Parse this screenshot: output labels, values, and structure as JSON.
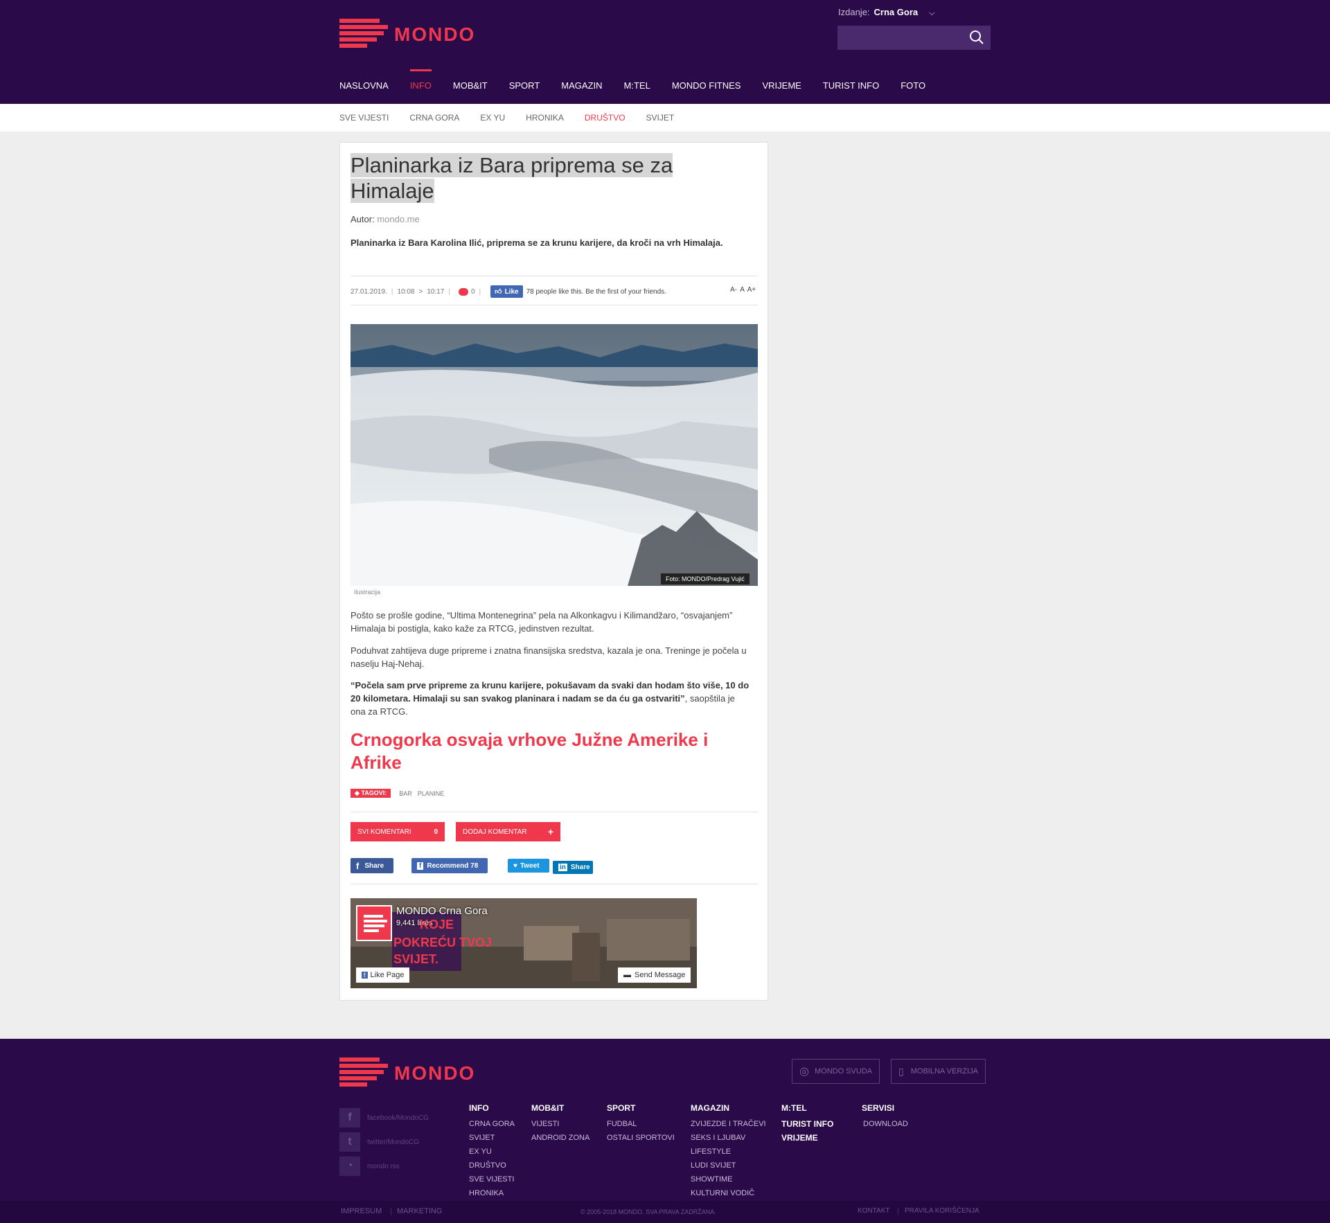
{
  "header": {
    "logo_text": "MONDO",
    "edition_label": "Izdanje:",
    "edition_value": "Crna Gora",
    "search_placeholder": ""
  },
  "main_nav": [
    "NASLOVNA",
    "INFO",
    "MOB&IT",
    "SPORT",
    "MAGAZIN",
    "M:TEL",
    "MONDO FITNES",
    "VRIJEME",
    "TURIST INFO",
    "FOTO"
  ],
  "main_nav_active": "INFO",
  "sub_nav": [
    "SVE VIJESTI",
    "CRNA GORA",
    "EX YU",
    "HRONIKA",
    "DRUŠTVO",
    "SVIJET"
  ],
  "sub_nav_active": "DRUŠTVO",
  "article": {
    "title": "Planinarka iz Bara priprema se za Himalaje",
    "author_label": "Autor:",
    "author": "mondo.me",
    "lead": "Planinarka iz Bara Karolina Ilić, priprema se za krunu karijere, da kroči na vrh Himalaja.",
    "date": "27.01.2019.",
    "time_published": "10:08",
    "arrow": ">",
    "time_updated": "10:17",
    "comments_count": "0",
    "fb_like_label": "Like",
    "fb_like_text": "78 people like this. Be the first of your friends.",
    "font_controls": "A- A A+",
    "photo_credit": "Foto: MONDO/Predrag Vujić",
    "photo_caption": "Ilustracija",
    "para1": "  Pošto se prošle godine, “Ultima Montenegrina” pela na Alkonkagvu i Kilimandžaro, “osvajanjem” Himalaja bi postigla, kako kaže za RTCG, jedinstven rezultat.",
    "para2": "Poduhvat zahtijeva duge pripreme i znatna finansijska sredstva, kazala je ona. Treninge je počela u naselju Haj-Nehaj.",
    "quote": "“Počela sam prve pripreme za krunu karijere, pokušavam da svaki dan hodam što više, 10 do 20 kilometara. Himalaji su san svakog planinara i nadam se da ću ga ostvariti”",
    "quote_tail": ", saopštila je ona za RTCG.",
    "subheading": "Crnogorka osvaja vrhove Južne Amerike i Afrike",
    "tags_label": "TAGOVI:",
    "tags": [
      "BAR",
      "PLANINE"
    ],
    "all_comments_label": "SVI KOMENTARI",
    "all_comments_count": "0",
    "add_comment_label": "DODAJ KOMENTAR",
    "add_comment_icon": "+",
    "share_fb": "Share",
    "recommend": "Recommend 78",
    "tweet": "Tweet",
    "share_li": "Share"
  },
  "fb_page": {
    "name": "MONDO Crna Gora",
    "likes": "9,441 likes",
    "banner_text": [
      "KOJE",
      "POKREĆU TVOJ",
      "SVIJET."
    ],
    "like_page": "Like Page",
    "send_message": "Send Message"
  },
  "footer": {
    "logo_text": "MONDO",
    "btn_everywhere": "MONDO SVUDA",
    "btn_mobile": "MOBILNA VERZIJA",
    "social": [
      "facebook/MondoCG",
      "twitter/MondoCG",
      "mondo rss"
    ],
    "columns": [
      {
        "head": "INFO",
        "items": [
          "CRNA GORA",
          "SVIJET",
          "EX YU",
          "DRUŠTVO",
          "SVE VIJESTI",
          "HRONIKA"
        ]
      },
      {
        "head": "MOB&IT",
        "items": [
          "VIJESTI",
          "ANDROID ZONA"
        ]
      },
      {
        "head": "SPORT",
        "items": [
          "FUDBAL",
          "OSTALI SPORTOVI"
        ]
      },
      {
        "head": "MAGAZIN",
        "items": [
          "ZVIJEZDE I TRAČEVI",
          "SEKS I LJUBAV",
          "LIFESTYLE",
          "LUDI SVIJET",
          "SHOWTIME",
          "KULTURNI VODIČ"
        ]
      },
      {
        "head": "M:TEL",
        "items": [
          "TURIST INFO",
          "VRIJEME"
        ]
      },
      {
        "head": "SERVISI",
        "items": [
          "DOWNLOAD"
        ]
      }
    ],
    "impresum": "IMPRESUM",
    "marketing": "MARKETING",
    "copyright": "© 2005-2018 MONDO. SVA PRAVA ZADRŽANA.",
    "kontakt": "KONTAKT",
    "rules": "PRAVILA KORIŠĆENJA"
  },
  "colors": {
    "brand": "#f0384c",
    "header_bg": "#2b0a4a"
  }
}
